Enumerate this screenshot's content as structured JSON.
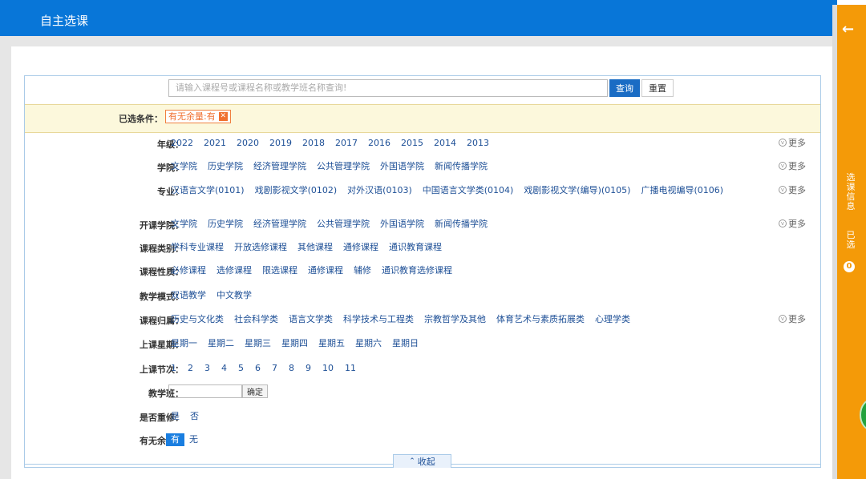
{
  "header": {
    "title": "自主选课"
  },
  "search": {
    "placeholder": "请输入课程号或课程名称或教学班名称查询!",
    "query_label": "查询",
    "reset_label": "重置"
  },
  "selected": {
    "label": "已选条件：",
    "tag": "有无余量:有",
    "remove_icon": "close-icon"
  },
  "filters": {
    "grade": {
      "label": "年级：",
      "options": [
        "2022",
        "2021",
        "2020",
        "2019",
        "2018",
        "2017",
        "2016",
        "2015",
        "2014",
        "2013"
      ],
      "more": "更多"
    },
    "college": {
      "label": "学院：",
      "options": [
        "文学院",
        "历史学院",
        "经济管理学院",
        "公共管理学院",
        "外国语学院",
        "新闻传播学院"
      ],
      "more": "更多"
    },
    "major": {
      "label": "专业：",
      "options": [
        "汉语言文学(0101)",
        "戏剧影视文学(0102)",
        "对外汉语(0103)",
        "中国语言文学类(0104)",
        "戏剧影视文学(编导)(0105)",
        "广播电视编导(0106)"
      ],
      "more": "更多"
    },
    "offering_college": {
      "label": "开课学院：",
      "options": [
        "文学院",
        "历史学院",
        "经济管理学院",
        "公共管理学院",
        "外国语学院",
        "新闻传播学院"
      ],
      "more": "更多"
    },
    "course_category": {
      "label": "课程类别：",
      "options": [
        "学科专业课程",
        "开放选修课程",
        "其他课程",
        "通修课程",
        "通识教育课程"
      ]
    },
    "course_nature": {
      "label": "课程性质：",
      "options": [
        "必修课程",
        "选修课程",
        "限选课程",
        "通修课程",
        "辅修",
        "通识教育选修课程"
      ]
    },
    "teaching_mode": {
      "label": "教学模式：",
      "options": [
        "双语教学",
        "中文教学"
      ]
    },
    "course_group": {
      "label": "课程归属：",
      "options": [
        "历史与文化类",
        "社会科学类",
        "语言文学类",
        "科学技术与工程类",
        "宗教哲学及其他",
        "体育艺术与素质拓展类",
        "心理学类"
      ],
      "more": "更多"
    },
    "weekday": {
      "label": "上课星期：",
      "options": [
        "星期一",
        "星期二",
        "星期三",
        "星期四",
        "星期五",
        "星期六",
        "星期日"
      ]
    },
    "period": {
      "label": "上课节次：",
      "options": [
        "1",
        "2",
        "3",
        "4",
        "5",
        "6",
        "7",
        "8",
        "9",
        "10",
        "11"
      ]
    },
    "teaching_class": {
      "label": "教学班：",
      "confirm": "确定"
    },
    "retake": {
      "label": "是否重修：",
      "options": [
        "是",
        "否"
      ]
    },
    "remaining": {
      "label": "有无余量：",
      "options": [
        "有",
        "无"
      ],
      "selected": "有"
    }
  },
  "collapse_label": "收起",
  "sidebar": {
    "text1": "选课信息",
    "text2": "已选",
    "count": "0"
  }
}
